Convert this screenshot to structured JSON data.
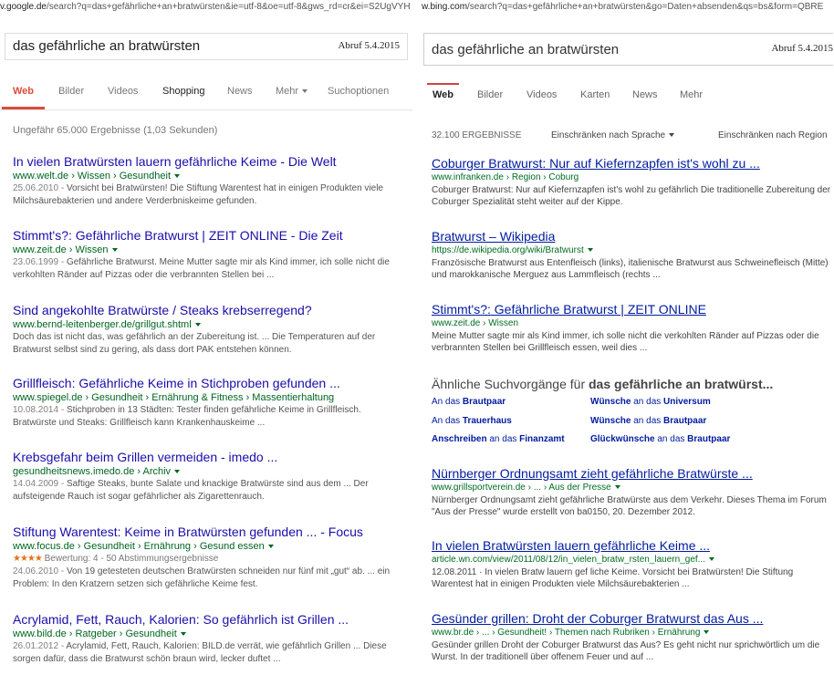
{
  "google": {
    "url_prefix": "v.google.de",
    "url_rest": "/search?q=das+gefährliche+an+bratwürsten&ie=utf-8&oe=utf-8&gws_rd=cr&ei=S2UgVYH",
    "query": "das gefährliche an bratwürsten",
    "abruf": "Abruf 5.4.2015",
    "tabs": [
      "Web",
      "Bilder",
      "Videos",
      "Shopping",
      "News",
      "Mehr",
      "Suchoptionen"
    ],
    "stats": "Ungefähr 65.000 Ergebnisse (1,03 Sekunden)",
    "results": [
      {
        "title": "In vielen Bratwürsten lauern gefährliche Keime - Die Welt",
        "cite": "www.welt.de › Wissen › Gesundheit",
        "date": "25.06.2010 - ",
        "snippet": "Vorsicht bei Bratwürsten! Die Stiftung Warentest hat in einigen Produkten viele Milchsäurebakterien und andere Verderbniskeime gefunden."
      },
      {
        "title": "Stimmt's?: Gefährliche Bratwurst | ZEIT ONLINE - Die Zeit",
        "cite": "www.zeit.de › Wissen",
        "date": "23.06.1999 - ",
        "snippet": "Gefährliche Bratwurst. Meine Mutter sagte mir als Kind immer, ich solle nicht die verkohlten Ränder auf Pizzas oder die verbrannten Stellen bei ..."
      },
      {
        "title": "Sind angekohlte Bratwürste / Steaks krebserregend?",
        "cite": "www.bernd-leitenberger.de/grillgut.shtml",
        "date": "",
        "snippet": "Doch das ist nicht das, was gefährlich an der Zubereitung ist. ... Die Temperaturen auf der Bratwurst selbst sind zu gering, als dass dort PAK entstehen können."
      },
      {
        "title": "Grillfleisch: Gefährliche Keime in Stichproben gefunden ...",
        "cite": "www.spiegel.de › Gesundheit › Ernährung & Fitness › Massentierhaltung",
        "date": "10.08.2014 - ",
        "snippet": "Stichproben in 13 Städten: Tester finden gefährliche Keime in Grillfleisch. Bratwürste und Steaks: Grillfleisch kann Krankenhauskeime ..."
      },
      {
        "title": "Krebsgefahr beim Grillen vermeiden - imedo ...",
        "cite": "gesundheitsnews.imedo.de › Archiv",
        "date": "14.04.2009 - ",
        "snippet": "Saftige Steaks, bunte Salate und knackige Bratwürste sind aus dem ... Der aufsteigende Rauch ist sogar gefährlicher als Zigarettenrauch."
      },
      {
        "title": "Stiftung Warentest: Keime in Bratwürsten gefunden ... - Focus",
        "cite": "www.focus.de › Gesundheit › Ernährung › Gesund essen",
        "stars": "★★★★",
        "rating": "Bewertung: 4 - 50 Abstimmungsergebnisse",
        "date": "24.06.2010 - ",
        "snippet": "Von 19 getesteten deutschen Bratwürsten schneiden nur fünf mit „gut“ ab. ... ein Problem: In den Kratzern setzen sich gefährliche Keime fest."
      },
      {
        "title": "Acrylamid, Fett, Rauch, Kalorien: So gefährlich ist Grillen ...",
        "cite": "www.bild.de › Ratgeber › Gesundheit",
        "date": "26.01.2012 - ",
        "snippet": "Acrylamid, Fett, Rauch, Kalorien: BILD.de verrät, wie gefährlich Grillen ... Diese sorgen dafür, dass die Bratwurst schön braun wird, lecker duftet ..."
      }
    ]
  },
  "bing": {
    "url_prefix": "w.bing.com",
    "url_rest": "/search?q=das+gefährliche+an+bratwürsten&go=Daten+absenden&qs=bs&form=QBRE",
    "query": "das gefährliche an bratwürsten",
    "abruf": "Abruf 5.4.2015",
    "tabs": [
      "Web",
      "Bilder",
      "Videos",
      "Karten",
      "News",
      "Mehr"
    ],
    "count": "32.100 ERGEBNISSE",
    "filter_language": "Einschränken nach Sprache",
    "filter_region": "Einschränken nach Region",
    "results_top": [
      {
        "title": "Coburger Bratwurst: Nur auf Kiefernzapfen ist's wohl zu ...",
        "cite": "www.infranken.de › Region › Coburg",
        "snippet": "Coburger Bratwurst: Nur auf Kiefernzapfen ist's wohl zu gefährlich Die traditionelle Zubereitung der Coburger Spezialität steht weiter auf der Kippe."
      },
      {
        "title": "Bratwurst – Wikipedia",
        "cite": "https://de.wikipedia.org/wiki/Bratwurst",
        "snippet": "Französische Bratwurst aus Entenfleisch (links), italienische Bratwurst aus Schweinefleisch (Mitte) und marokkanische Merguez aus Lammfleisch (rechts ..."
      },
      {
        "title": "Stimmt's?: Gefährliche Bratwurst | ZEIT ONLINE",
        "cite": "www.zeit.de › Wissen",
        "snippet": "Meine Mutter sagte mir als Kind immer, ich solle nicht die verkohlten Ränder auf Pizzas oder die verbrannten Stellen bei Grillfleisch essen, weil dies ..."
      }
    ],
    "related_prefix": "Ähnliche Suchvorgänge für ",
    "related_query": "das gefährliche an bratwürst...",
    "related": [
      {
        "pre": "An das ",
        "bold": "Brautpaar",
        "post": ""
      },
      {
        "pre": "Wünsche ",
        "bold": "",
        "mid": "an das ",
        "bold2": "Universum"
      },
      {
        "pre": "An das ",
        "bold": "Trauerhaus",
        "post": ""
      },
      {
        "pre": "Wünsche ",
        "bold": "",
        "mid": "an das ",
        "bold2": "Brautpaar"
      },
      {
        "pre": "Anschreiben ",
        "bold": "",
        "mid": "an das ",
        "bold2": "Finanzamt"
      },
      {
        "pre": "Glückwünsche ",
        "bold": "",
        "mid": "an das ",
        "bold2": "Brautpaar"
      }
    ],
    "results_bottom": [
      {
        "title": "Nürnberger Ordnungsamt zieht gefährliche Bratwürste ...",
        "cite": "www.grillsportverein.de › ... › Aus der Presse",
        "snippet": "Nürnberger Ordnungsamt zieht gefährliche Bratwürste aus dem Verkehr. Dieses Thema im Forum \"Aus der Presse\" wurde erstellt von ba0150, 20. Dezember 2012."
      },
      {
        "title": "In vielen Bratwürsten lauern gefährliche Keime ...",
        "cite": "article.wn.com/view/2011/08/12/in_vielen_bratw_rsten_lauern_gef...",
        "snippet": "12.08.2011 · In vielen Bratw lauern gef liche Keime. Vorsicht bei Bratwürsten! Die Stiftung Warentest hat in einigen Produkten viele Milchsäurebakterien ..."
      },
      {
        "title": "Gesünder grillen: Droht der Coburger Bratwurst das Aus ...",
        "cite": "www.br.de › ... › Gesundheit! › Themen nach Rubriken › Ernährung",
        "snippet": "Gesünder grillen Droht der Coburger Bratwurst das Aus? Es geht nicht nur sprichwörtlich um die Wurst. In der traditionell über offenem Feuer und auf ..."
      }
    ]
  }
}
